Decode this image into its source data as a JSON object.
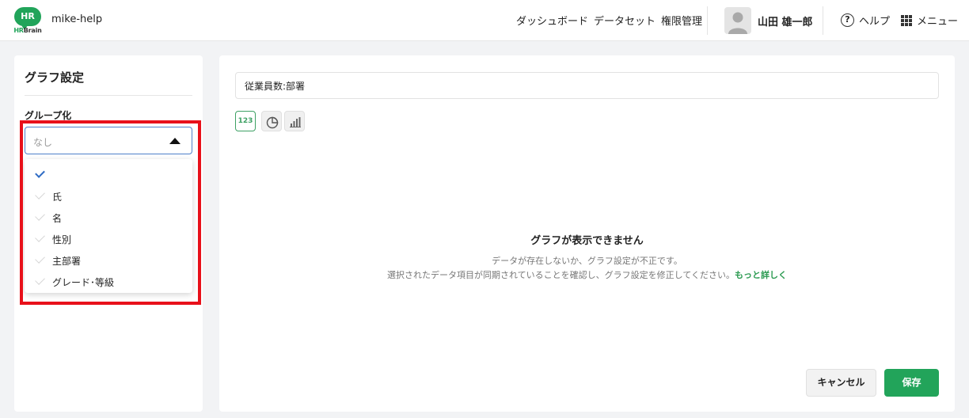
{
  "header": {
    "logo_mark": "HR",
    "logo_text_hr": "HR",
    "logo_text_brain": "Brain",
    "app_name": "mike-help",
    "nav": [
      {
        "label": "ダッシュボード"
      },
      {
        "label": "データセット"
      },
      {
        "label": "権限管理"
      }
    ],
    "user_name": "山田 雄一郎",
    "help_label": "ヘルプ",
    "menu_label": "メニュー"
  },
  "left_panel": {
    "title": "グラフ設定",
    "group_label": "グループ化",
    "select_placeholder": "なし",
    "options": [
      {
        "label": "",
        "selected": true
      },
      {
        "label": "氏",
        "selected": false
      },
      {
        "label": "名",
        "selected": false
      },
      {
        "label": "性別",
        "selected": false
      },
      {
        "label": "主部署",
        "selected": false
      },
      {
        "label": "グレード･等級",
        "selected": false
      }
    ]
  },
  "right_panel": {
    "graph_title_value": "従業員数:部署",
    "chart_types": [
      {
        "name": "number",
        "label": "123",
        "active": true
      },
      {
        "name": "pie",
        "active": false
      },
      {
        "name": "bar",
        "active": false
      }
    ],
    "empty_title": "グラフが表示できません",
    "empty_desc1": "データが存在しないか、グラフ設定が不正です。",
    "empty_desc2": "選択されたデータ項目が同期されていることを確認し、グラフ設定を修正してください。",
    "empty_link": "もっと詳しく",
    "cancel_label": "キャンセル",
    "save_label": "保存"
  },
  "colors": {
    "brand": "#21a45a",
    "highlight": "#e8101a",
    "focus": "#4f7fc9",
    "check": "#2f6cc4"
  }
}
